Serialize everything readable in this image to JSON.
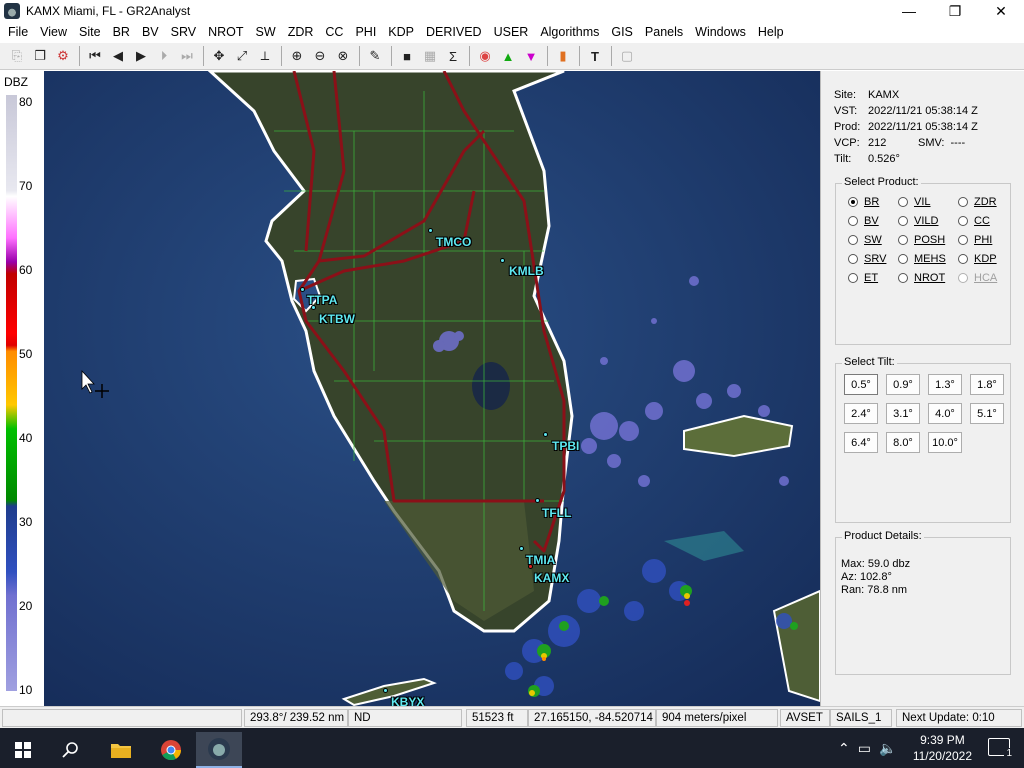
{
  "window": {
    "title": "KAMX Miami, FL - GR2Analyst",
    "minimize": "—",
    "maximize": "❐",
    "close": "✕"
  },
  "menu": [
    "File",
    "View",
    "Site",
    "BR",
    "BV",
    "SRV",
    "NROT",
    "SW",
    "ZDR",
    "CC",
    "PHI",
    "KDP",
    "DERIVED",
    "USER",
    "Algorithms",
    "GIS",
    "Panels",
    "Windows",
    "Help"
  ],
  "toolbar_icons": [
    "copy-icon",
    "copy-window-icon",
    "settings-icon",
    "first-frame-icon",
    "prev-frame-icon",
    "play-icon",
    "next-frame-icon",
    "last-frame-icon",
    "pan-icon",
    "measure-icon",
    "cross-section-icon",
    "zoom-in-icon",
    "zoom-out-icon",
    "zoom-reset-icon",
    "eyedropper-icon",
    "stop-icon",
    "grid-icon",
    "sum-icon",
    "hurricane-icon",
    "triangle-up-icon",
    "triangle-down-icon",
    "panel-icon",
    "text-icon",
    "box-icon"
  ],
  "colors": {
    "map_water": "#1f3b6e",
    "site_label": "#5ee8f0",
    "highway": "#8b1018",
    "county_line": "#3cba3c"
  },
  "scale": {
    "title": "DBZ",
    "labels": [
      "80",
      "70",
      "60",
      "50",
      "40",
      "30",
      "20",
      "10"
    ]
  },
  "map": {
    "sites": [
      {
        "label": "TMCO"
      },
      {
        "label": "KMLB"
      },
      {
        "label": "TTPA"
      },
      {
        "label": "KTBW"
      },
      {
        "label": "TPBI"
      },
      {
        "label": "TFLL"
      },
      {
        "label": "TMIA"
      },
      {
        "label": "KAMX"
      },
      {
        "label": "KBYX"
      }
    ]
  },
  "info": {
    "site_label": "Site:",
    "site": "KAMX",
    "vst_label": "VST:",
    "vst": "2022/11/21  05:38:14 Z",
    "prod_label": "Prod:",
    "prod": "2022/11/21  05:38:14 Z",
    "vcp_label": "VCP:",
    "vcp": "212",
    "smv_label": "SMV:",
    "smv": "----",
    "tilt_label": "Tilt:",
    "tilt": "0.526°"
  },
  "select_product": {
    "title": "Select Product:",
    "options": [
      {
        "label": "BR",
        "selected": true,
        "enabled": true
      },
      {
        "label": "VIL",
        "selected": false,
        "enabled": true
      },
      {
        "label": "ZDR",
        "selected": false,
        "enabled": true
      },
      {
        "label": "BV",
        "selected": false,
        "enabled": true
      },
      {
        "label": "VILD",
        "selected": false,
        "enabled": true
      },
      {
        "label": "CC",
        "selected": false,
        "enabled": true
      },
      {
        "label": "SW",
        "selected": false,
        "enabled": true
      },
      {
        "label": "POSH",
        "selected": false,
        "enabled": true
      },
      {
        "label": "PHI",
        "selected": false,
        "enabled": true
      },
      {
        "label": "SRV",
        "selected": false,
        "enabled": true
      },
      {
        "label": "MEHS",
        "selected": false,
        "enabled": true
      },
      {
        "label": "KDP",
        "selected": false,
        "enabled": true
      },
      {
        "label": "ET",
        "selected": false,
        "enabled": true
      },
      {
        "label": "NROT",
        "selected": false,
        "enabled": true
      },
      {
        "label": "HCA",
        "selected": false,
        "enabled": false
      }
    ]
  },
  "select_tilt": {
    "title": "Select Tilt:",
    "tilts": [
      "0.5°",
      "0.9°",
      "1.3°",
      "1.8°",
      "2.4°",
      "3.1°",
      "4.0°",
      "5.1°",
      "6.4°",
      "8.0°",
      "10.0°"
    ],
    "active": "0.5°"
  },
  "product_details": {
    "title": "Product Details:",
    "max": "Max:  59.0 dbz",
    "az": "Az:   102.8°",
    "ran": "Ran:  78.8 nm"
  },
  "status": {
    "az_range": "293.8°/ 239.52 nm",
    "value": "ND",
    "height": "51523 ft",
    "latlon": "27.165150, -84.520714",
    "resolution": "904 meters/pixel",
    "avset": "AVSET",
    "sails": "SAILS_1",
    "next_update": "Next Update: 0:10"
  },
  "taskbar": {
    "time": "9:39 PM",
    "date": "11/20/2022",
    "notifications": "1"
  }
}
